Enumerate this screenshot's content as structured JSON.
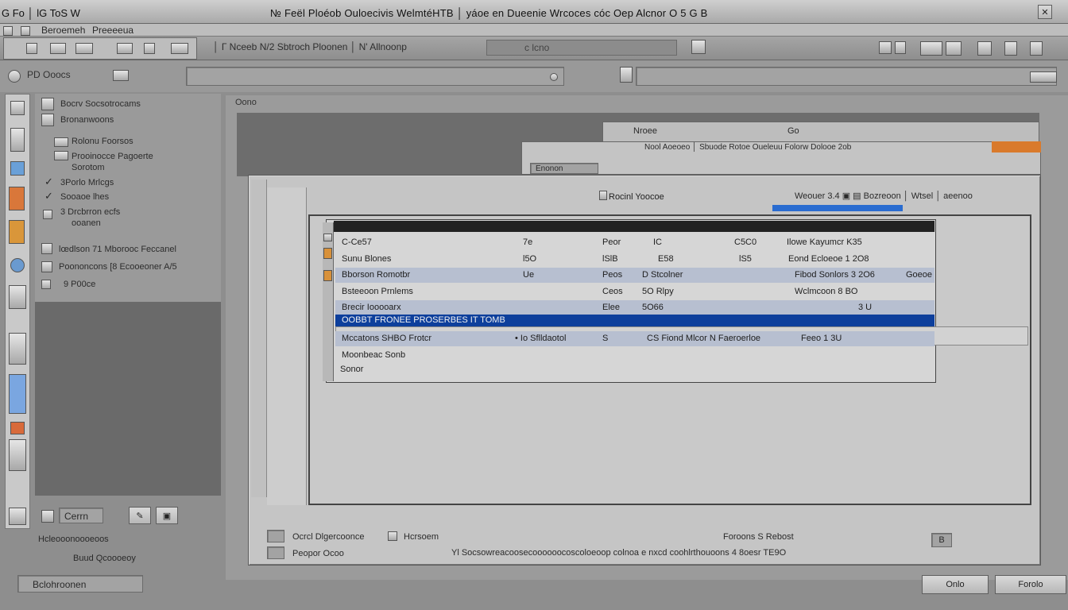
{
  "titlebar": {
    "app_title": "G Fo │ lG ToS  W",
    "window_title": "№ Feël  Ploéob Ouloecivis  WelmtéHTB │ yáoe en Dueenie Wrcoces  cóc Oep Alcnor  O 5 G B"
  },
  "menu": {
    "item1": "Beroemeh",
    "item2": "Preeeeua"
  },
  "toolbar": {
    "label": "│ Г Nceeb  N/2 Sbtroch  Ploonen    │ N' Allnoonp",
    "field_text": "c  lcno"
  },
  "address": {
    "label": "PD  Ooocs"
  },
  "tree": {
    "items": [
      "Bocrv  Socsotrocams",
      "Bronanwoons",
      "Rolonu Foorsos",
      "Prooinocce  Pagoerte",
      "Sorotom",
      "3Porlo Mrlcgs",
      "Sooaoe  lhes",
      "3 Drcbrron ecfs",
      "ooanen",
      "lœdlson   71    Mborooc  Feccanel",
      "Poononcons   [8  Ecooeoner  A/5",
      "9 P00ce"
    ],
    "bottom_field": "Cerrn"
  },
  "center": {
    "label": "Oono",
    "back_window_1": "Nroee",
    "back_window_1b": "Go",
    "back_window_2": "Nool  Aoeoeo  │  Sbuode  Rotoe  Oueleuu Folorw Dolooe 2ob",
    "back_window_2_small": "Enonon"
  },
  "dialog": {
    "title": "Rocinl  Yoocoe",
    "top_right": "Weouer 3.4  ▣  ▤ Bozreoon  │ Wtsel  │ aeenoo",
    "rows": [
      {
        "c1": "C-Ce57",
        "c2": "7e",
        "c3": "Peor",
        "c4": "IC",
        "c5": "C5C0",
        "c6": "Ilowe Kayumcr  K35",
        "c7": ""
      },
      {
        "c1": "Sunu  Blones",
        "c2": "l5O",
        "c3": "lSlB",
        "c4": "E58",
        "c5": "lS5",
        "c6": "Eond  Ecloeoe  1 2O8",
        "c7": ""
      },
      {
        "c1": "Bborson  Romotbr",
        "c2": "Ue",
        "c3": "Peos",
        "c4": "D  Stcolner",
        "c5": "",
        "c6": "Fibod  Sonlors  3  2O6",
        "c7": "Goeoe"
      },
      {
        "c1": "Bsteeoon  Prnlems",
        "c2": "",
        "c3": "Ceos",
        "c4": "5O  Rlpy",
        "c5": "",
        "c6": "Wclmcoon  8  BO",
        "c7": ""
      },
      {
        "c1": "Brecir  Iooooarx",
        "c2": "",
        "c3": "Elee",
        "c4": "5O66",
        "c5": "",
        "c6": "3  U",
        "c7": ""
      },
      {
        "c1": "OOBBT FRONEE PROSERBES  IT TOMB",
        "c2": "",
        "c3": "",
        "c4": "",
        "c5": "",
        "c6": "",
        "c7": ""
      },
      {
        "c1": "Mccatons  SHBO  Frotcr",
        "c2": "• Io  Sflldaotol",
        "c3": "S",
        "c4": "CS  Fiond Mlcor  N  Faeroerloe",
        "c5": "",
        "c6": "Feeo  1 3U",
        "c7": ""
      },
      {
        "c1": "Moonbeac  Sonb",
        "c2": "",
        "c3": "",
        "c4": "",
        "c5": "",
        "c6": "",
        "c7": ""
      },
      {
        "c1": "Sonor",
        "c2": "",
        "c3": "",
        "c4": "",
        "c5": "",
        "c6": "",
        "c7": ""
      }
    ]
  },
  "footer": {
    "left_1": "Hcleooonoooeoos",
    "left_2": "Buud  Qcoooeoy",
    "left_field": "Bclohroonen",
    "status_left": "Ocrcl  Dlgercoonce",
    "status_mid": "Hcrsoem",
    "status_right": "Foroons  S  Rebost",
    "status_box": "B",
    "footer_left": "Peopor  Ocoo",
    "footer_text": "Yl  Socsowreacoosecoooooocoscoloeoop  colnoa  e nxcd  coohlrthouoons  4  8oesr  TE9O",
    "ok": "Onlo",
    "cancel": "Forolo"
  }
}
